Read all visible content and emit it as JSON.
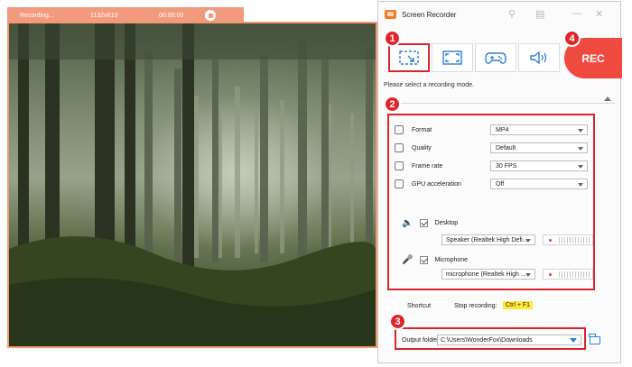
{
  "recording_bar": {
    "status": "Recording...",
    "size": "1132x610",
    "time": "00:00:00"
  },
  "window": {
    "title": "Screen Recorder",
    "hint": "Please select a recording mode.",
    "rec_label": "REC"
  },
  "modes": [
    {
      "icon": "region-select-icon",
      "selected": true
    },
    {
      "icon": "fullscreen-icon",
      "selected": false
    },
    {
      "icon": "gamepad-icon",
      "selected": false
    },
    {
      "icon": "audio-only-icon",
      "selected": false
    }
  ],
  "settings": {
    "format": {
      "label": "Format",
      "value": "MP4"
    },
    "quality": {
      "label": "Quality",
      "value": "Default"
    },
    "frame_rate": {
      "label": "Frame rate",
      "value": "30 FPS"
    },
    "gpu": {
      "label": "GPU acceleration",
      "value": "Off"
    }
  },
  "audio": {
    "desktop": {
      "label": "Desktop",
      "device": "Speaker (Realtek High Defi...",
      "checked": true
    },
    "microphone": {
      "label": "Microphone",
      "device": "microphone (Realtek High ...",
      "checked": true
    }
  },
  "shortcut": {
    "label": "Shortcut",
    "stop_label": "Stop recording:",
    "hotkey": "Ctrl + F1"
  },
  "output": {
    "label": "Output folder:",
    "path": "C:\\Users\\WonderFox\\Downloads"
  },
  "badges": [
    "1",
    "2",
    "3",
    "4"
  ],
  "colors": {
    "accent_red": "#d9252b",
    "rec_button": "#ef4a3f",
    "capture_border": "#f39a6e",
    "hotkey_highlight": "#ffea3a"
  }
}
